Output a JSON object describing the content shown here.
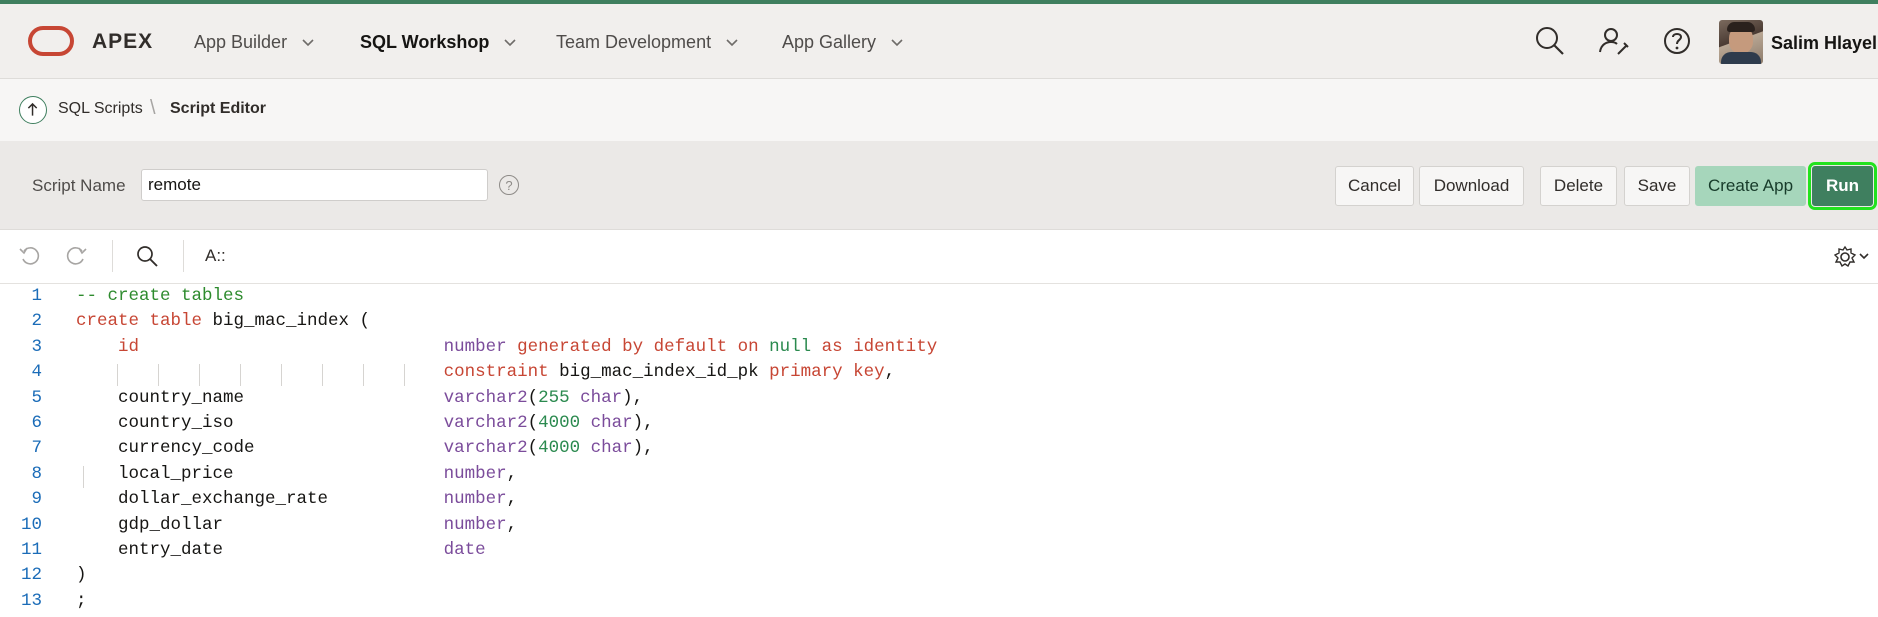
{
  "header": {
    "brand": "APEX",
    "nav": [
      {
        "label": "App Builder"
      },
      {
        "label": "SQL Workshop"
      },
      {
        "label": "Team Development"
      },
      {
        "label": "App Gallery"
      }
    ],
    "user_name": "Salim Hlayel"
  },
  "breadcrumb": {
    "parent": "SQL Scripts",
    "current": "Script Editor"
  },
  "toolbar": {
    "script_name_label": "Script Name",
    "script_name_value": "remote",
    "help_glyph": "?",
    "buttons": {
      "cancel": "Cancel",
      "download": "Download",
      "delete": "Delete",
      "save": "Save",
      "create_app": "Create App",
      "run": "Run"
    }
  },
  "editor_toolbar": {
    "format_label": "A::"
  },
  "editor": {
    "line_numbers": [
      "1",
      "2",
      "3",
      "4",
      "5",
      "6",
      "7",
      "8",
      "9",
      "10",
      "11",
      "12",
      "13"
    ],
    "lines": [
      [
        {
          "t": "-- create tables",
          "c": "cm"
        }
      ],
      [
        {
          "t": "create table",
          "c": "kw"
        },
        {
          "t": " big_mac_index (",
          "c": ""
        }
      ],
      [
        {
          "t": "    ",
          "c": ""
        },
        {
          "t": "id",
          "c": "kw"
        },
        {
          "t": "                             ",
          "c": ""
        },
        {
          "t": "number",
          "c": "ty"
        },
        {
          "t": " generated by default on ",
          "c": "kw"
        },
        {
          "t": "null",
          "c": "nu"
        },
        {
          "t": " as identity",
          "c": "kw"
        }
      ],
      [
        {
          "t": "                                   ",
          "c": ""
        },
        {
          "t": "constraint",
          "c": "kw"
        },
        {
          "t": " big_mac_index_id_pk ",
          "c": ""
        },
        {
          "t": "primary key",
          "c": "kw"
        },
        {
          "t": ",",
          "c": ""
        }
      ],
      [
        {
          "t": "    country_name                   ",
          "c": ""
        },
        {
          "t": "varchar2",
          "c": "ty"
        },
        {
          "t": "(",
          "c": ""
        },
        {
          "t": "255",
          "c": "nu"
        },
        {
          "t": " ",
          "c": ""
        },
        {
          "t": "char",
          "c": "ty"
        },
        {
          "t": "),",
          "c": ""
        }
      ],
      [
        {
          "t": "    country_iso                    ",
          "c": ""
        },
        {
          "t": "varchar2",
          "c": "ty"
        },
        {
          "t": "(",
          "c": ""
        },
        {
          "t": "4000",
          "c": "nu"
        },
        {
          "t": " ",
          "c": ""
        },
        {
          "t": "char",
          "c": "ty"
        },
        {
          "t": "),",
          "c": ""
        }
      ],
      [
        {
          "t": "    currency_code                  ",
          "c": ""
        },
        {
          "t": "varchar2",
          "c": "ty"
        },
        {
          "t": "(",
          "c": ""
        },
        {
          "t": "4000",
          "c": "nu"
        },
        {
          "t": " ",
          "c": ""
        },
        {
          "t": "char",
          "c": "ty"
        },
        {
          "t": "),",
          "c": ""
        }
      ],
      [
        {
          "t": "    local_price                    ",
          "c": ""
        },
        {
          "t": "number",
          "c": "ty"
        },
        {
          "t": ",",
          "c": ""
        }
      ],
      [
        {
          "t": "    dollar_exchange_rate           ",
          "c": ""
        },
        {
          "t": "number",
          "c": "ty"
        },
        {
          "t": ",",
          "c": ""
        }
      ],
      [
        {
          "t": "    gdp_dollar                     ",
          "c": ""
        },
        {
          "t": "number",
          "c": "ty"
        },
        {
          "t": ",",
          "c": ""
        }
      ],
      [
        {
          "t": "    entry_date                     ",
          "c": ""
        },
        {
          "t": "date",
          "c": "ty"
        }
      ],
      [
        {
          "t": ")",
          "c": ""
        }
      ],
      [
        {
          "t": ";",
          "c": ""
        }
      ]
    ]
  },
  "colors": {
    "accent": "#3f7f5f",
    "brand_red": "#c74634",
    "run_highlight": "#22e21e"
  }
}
